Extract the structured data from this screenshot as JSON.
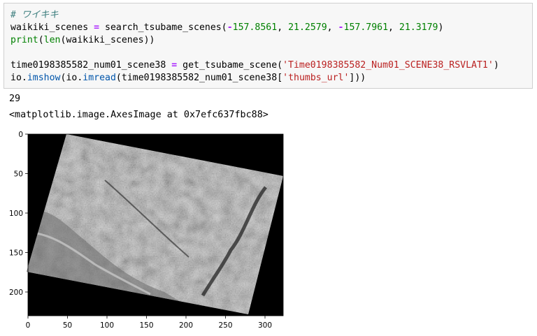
{
  "code_lines": [
    {
      "kind": "comment",
      "text": "# ワイキキ"
    },
    {
      "kind": "call",
      "var": "waikiki_scenes",
      "fn": "search_tsubame_scenes",
      "args": [
        "-",
        "157.8561",
        ", ",
        "21.2579",
        ", ",
        "-",
        "157.7961",
        ", ",
        "21.3179"
      ]
    },
    {
      "kind": "print",
      "text": "print",
      "inner": "len",
      "arg": "waikiki_scenes"
    },
    {
      "kind": "blank"
    },
    {
      "kind": "get",
      "var": "time0198385582_num01_scene38",
      "fn": "get_tsubame_scene",
      "arg": "'Time0198385582_Num01_SCENE38_RSVLAT1'"
    },
    {
      "kind": "show",
      "mod": "io",
      "fn1": "imshow",
      "fn2": "imread",
      "var": "time0198385582_num01_scene38",
      "key": "'thumbs_url'"
    }
  ],
  "outputs": {
    "count": "29",
    "repr": "<matplotlib.image.AxesImage at 0x7efc637fbc88>"
  },
  "plot": {
    "y_ticks": [
      "0",
      "50",
      "100",
      "150",
      "200"
    ],
    "x_ticks": [
      "0",
      "50",
      "100",
      "150",
      "200",
      "250",
      "300"
    ],
    "x_range": [
      0,
      323
    ],
    "y_range": [
      0,
      230
    ],
    "image_background": "#000000"
  }
}
